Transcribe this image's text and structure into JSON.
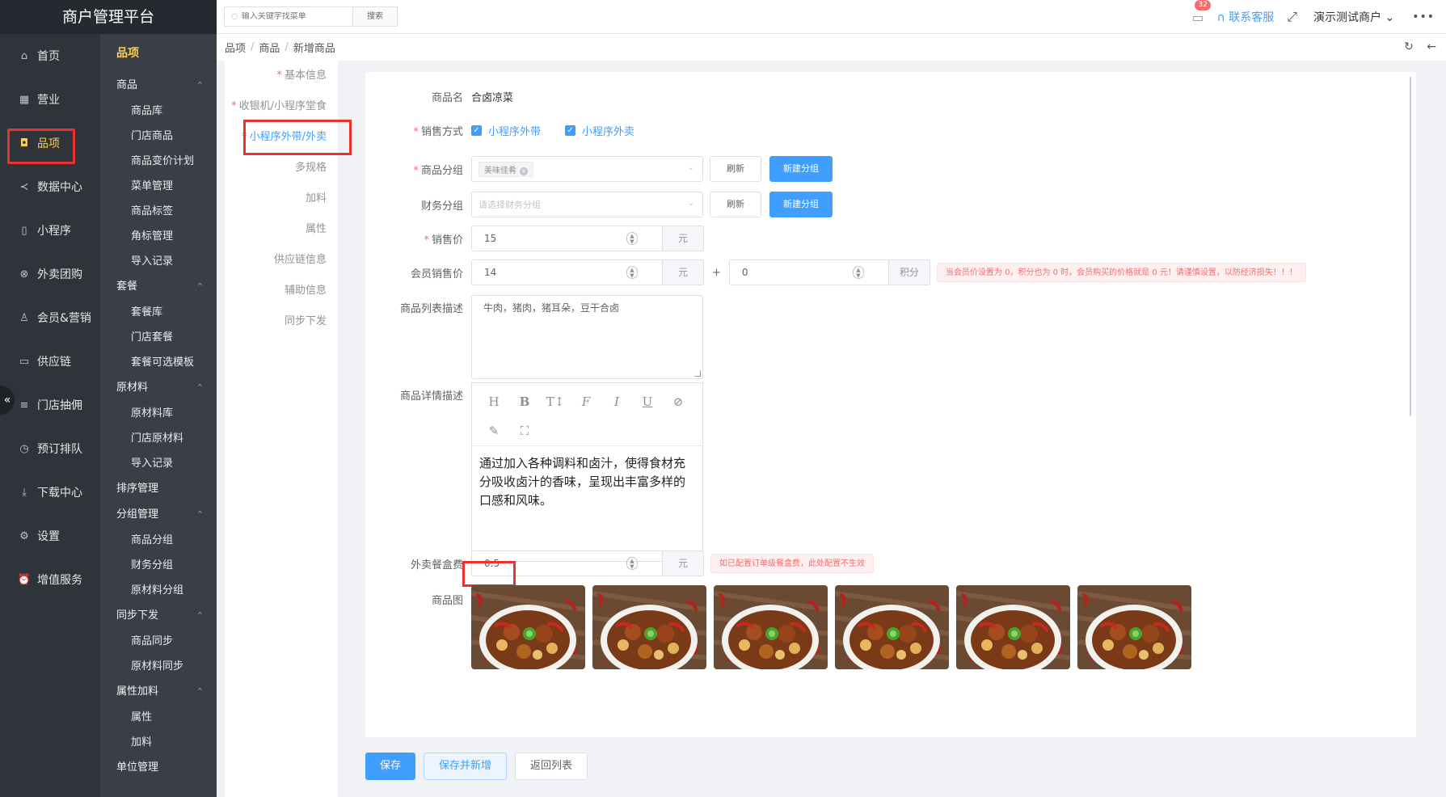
{
  "brand": "商户管理平台",
  "primary_nav": [
    {
      "label": "首页",
      "icon": "home-icon",
      "glyph": "⌂"
    },
    {
      "label": "营业",
      "icon": "calendar-icon",
      "glyph": "▦"
    },
    {
      "label": "品项",
      "icon": "bag-icon",
      "glyph": "◘"
    },
    {
      "label": "数据中心",
      "icon": "share-icon",
      "glyph": "≺"
    },
    {
      "label": "小程序",
      "icon": "phone-icon",
      "glyph": "▯"
    },
    {
      "label": "外卖团购",
      "icon": "bike-icon",
      "glyph": "⊗"
    },
    {
      "label": "会员&营销",
      "icon": "user-icon",
      "glyph": "♙"
    },
    {
      "label": "供应链",
      "icon": "truck-icon",
      "glyph": "▭"
    },
    {
      "label": "门店抽佣",
      "icon": "coins-icon",
      "glyph": "≡"
    },
    {
      "label": "预订排队",
      "icon": "clock-icon",
      "glyph": "◷"
    },
    {
      "label": "下载中心",
      "icon": "download-icon",
      "glyph": "⤓"
    },
    {
      "label": "设置",
      "icon": "gear-icon",
      "glyph": "⚙"
    },
    {
      "label": "增值服务",
      "icon": "alarm-icon",
      "glyph": "⏰"
    }
  ],
  "secondary_nav": {
    "title": "品项",
    "groups": [
      {
        "label": "商品",
        "items": [
          "商品库",
          "门店商品",
          "商品变价计划",
          "菜单管理",
          "商品标签",
          "角标管理",
          "导入记录"
        ]
      },
      {
        "label": "套餐",
        "items": [
          "套餐库",
          "门店套餐",
          "套餐可选模板"
        ]
      },
      {
        "label": "原材料",
        "items": [
          "原材料库",
          "门店原材料",
          "导入记录"
        ]
      },
      {
        "label": "排序管理",
        "items": []
      },
      {
        "label": "分组管理",
        "items": [
          "商品分组",
          "财务分组",
          "原材料分组"
        ]
      },
      {
        "label": "同步下发",
        "items": [
          "商品同步",
          "原材料同步"
        ]
      },
      {
        "label": "属性加料",
        "items": [
          "属性",
          "加料"
        ]
      },
      {
        "label": "单位管理",
        "items": []
      }
    ]
  },
  "topbar": {
    "search_placeholder": "输入关键字找菜单",
    "search_button": "搜索",
    "message_count": "32",
    "contact": "联系客服",
    "merchant": "演示测试商户",
    "more": "•••"
  },
  "breadcrumb": [
    "品项",
    "商品",
    "新增商品"
  ],
  "steps": [
    {
      "label": "基本信息",
      "required": true
    },
    {
      "label": "收银机/小程序堂食",
      "required": true
    },
    {
      "label": "小程序外带/外卖",
      "required": true
    },
    {
      "label": "多规格",
      "required": false
    },
    {
      "label": "加料",
      "required": false
    },
    {
      "label": "属性",
      "required": false
    },
    {
      "label": "供应链信息",
      "required": false
    },
    {
      "label": "辅助信息",
      "required": false
    },
    {
      "label": "同步下发",
      "required": false
    }
  ],
  "form": {
    "name_label": "商品名",
    "name_value": "合卤凉菜",
    "sale_mode_label": "销售方式",
    "sale_mode_options": [
      "小程序外带",
      "小程序外卖"
    ],
    "category_label": "商品分组",
    "category_tag": "美味佳肴",
    "refresh": "刷新",
    "new_group": "新建分组",
    "finance_label": "财务分组",
    "finance_placeholder": "请选择财务分组",
    "price_label": "销售价",
    "price_value": "15",
    "unit_yuan": "元",
    "member_price_label": "会员销售价",
    "member_price_value": "14",
    "plus": "+",
    "points_value": "0",
    "unit_points": "积分",
    "member_warning": "当会员价设置为 0，积分也为 0 时，会员购买的价格就是 0 元！请谨慎设置，以防经济损失！！！",
    "list_desc_label": "商品列表描述",
    "list_desc_value": "牛肉，猪肉，猪耳朵，豆干合卤",
    "detail_desc_label": "商品详情描述",
    "detail_desc_value": "通过加入各种调料和卤汁，使得食材充分吸收卤汁的香味，呈现出丰富多样的口感和风味。",
    "box_fee_label": "外卖餐盒费",
    "box_fee_value": "0.5",
    "box_fee_warning": "如已配置订单级餐盒费，此处配置不生效",
    "images_label": "商品图"
  },
  "actions": [
    "保存",
    "保存并新增",
    "返回列表"
  ],
  "colors": {
    "accent": "#409eff",
    "sidebar": "#2f343b",
    "highlight": "#e8332e",
    "active_nav": "#ffd04b"
  }
}
